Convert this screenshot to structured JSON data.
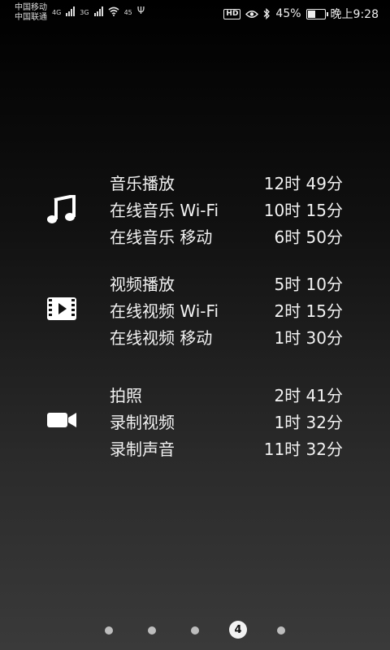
{
  "status_bar": {
    "carrier1": "中国移动",
    "carrier2": "中国联通",
    "net1": "4G",
    "net2": "3G",
    "wifi_speed": "45",
    "hd": "HD",
    "battery_percent": "45%",
    "battery_level": 0.45,
    "time": "晚上9:28"
  },
  "groups": [
    {
      "icon": "music-note-icon",
      "rows": [
        {
          "label": "音乐播放",
          "value": "12时 49分"
        },
        {
          "label": "在线音乐 Wi-Fi",
          "value": "10时 15分"
        },
        {
          "label": "在线音乐 移动",
          "value": "6时 50分"
        }
      ]
    },
    {
      "icon": "video-film-icon",
      "rows": [
        {
          "label": "视频播放",
          "value": "5时 10分"
        },
        {
          "label": "在线视频 Wi-Fi",
          "value": "2时 15分"
        },
        {
          "label": "在线视频 移动",
          "value": "1时 30分"
        }
      ]
    },
    {
      "icon": "camera-icon",
      "rows": [
        {
          "label": "拍照",
          "value": "2时 41分"
        },
        {
          "label": "录制视频",
          "value": "1时 32分"
        },
        {
          "label": "录制声音",
          "value": "11时 32分"
        }
      ]
    }
  ],
  "pager": {
    "active_page": "4",
    "total_pages": 5
  }
}
